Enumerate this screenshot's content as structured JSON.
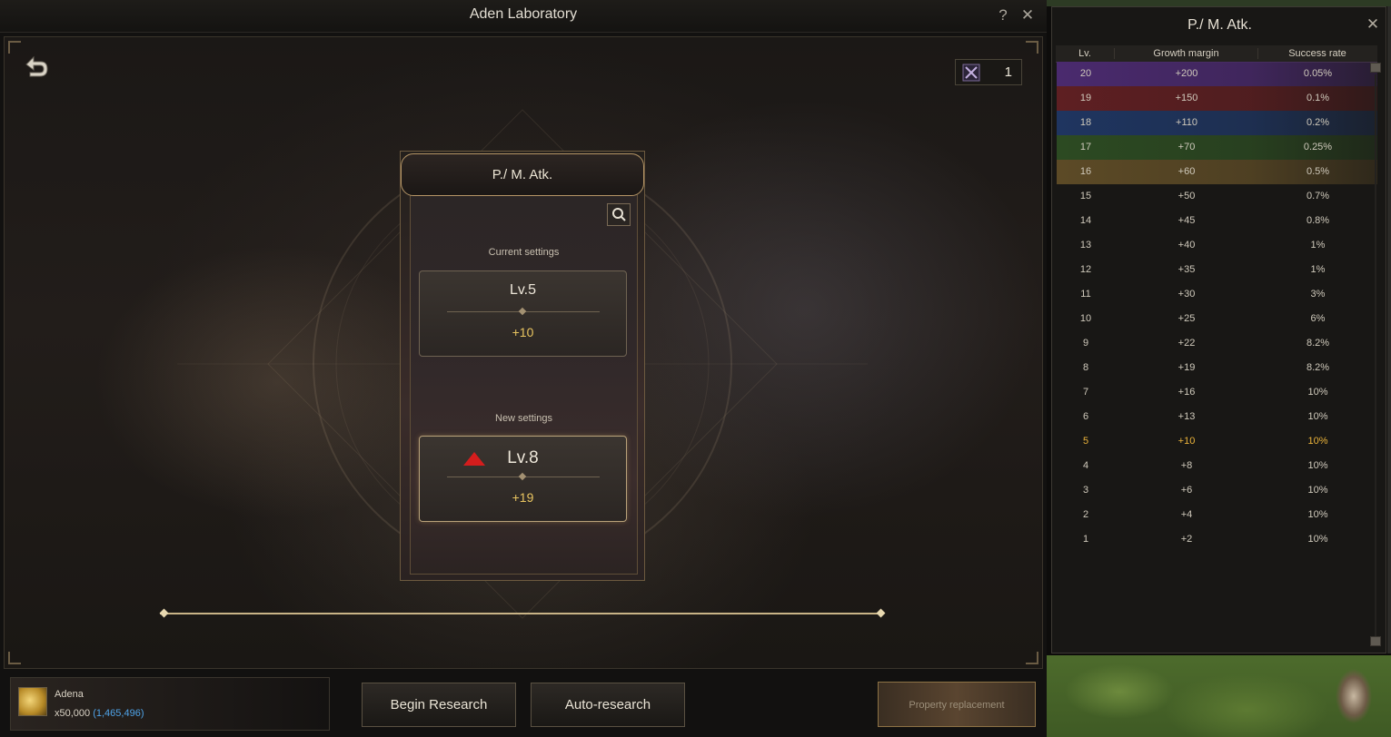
{
  "main_window": {
    "title": "Aden Laboratory",
    "help_glyph": "?",
    "close_glyph": "✕"
  },
  "ticket": {
    "icon": "crossed-swords-ticket-icon",
    "count": "1"
  },
  "card": {
    "stat_name": "P./ M. Atk.",
    "current_label": "Current settings",
    "current_level": "Lv.5",
    "current_value": "+10",
    "new_label": "New settings",
    "new_level": "Lv.8",
    "new_value": "+19",
    "new_indicator": "red-up-arrow-icon"
  },
  "adena": {
    "name": "Adena",
    "cost": "x50,000",
    "owned": "(1,465,496)"
  },
  "buttons": {
    "begin_research": "Begin Research",
    "auto_research": "Auto-research",
    "property_replacement": "Property replacement"
  },
  "side_panel": {
    "title": "P./ M. Atk.",
    "close_glyph": "✕",
    "columns": [
      "Lv.",
      "Growth margin",
      "Success rate"
    ],
    "rows": [
      {
        "lv": "20",
        "growth": "+200",
        "rate": "0.05%",
        "tier_color": "#4a2a6e"
      },
      {
        "lv": "19",
        "growth": "+150",
        "rate": "0.1%",
        "tier_color": "#5e1f22"
      },
      {
        "lv": "18",
        "growth": "+110",
        "rate": "0.2%",
        "tier_color": "#1f3560"
      },
      {
        "lv": "17",
        "growth": "+70",
        "rate": "0.25%",
        "tier_color": "#2c4a22"
      },
      {
        "lv": "16",
        "growth": "+60",
        "rate": "0.5%",
        "tier_color": "#5c4a26"
      },
      {
        "lv": "15",
        "growth": "+50",
        "rate": "0.7%",
        "tier_color": ""
      },
      {
        "lv": "14",
        "growth": "+45",
        "rate": "0.8%",
        "tier_color": ""
      },
      {
        "lv": "13",
        "growth": "+40",
        "rate": "1%",
        "tier_color": ""
      },
      {
        "lv": "12",
        "growth": "+35",
        "rate": "1%",
        "tier_color": ""
      },
      {
        "lv": "11",
        "growth": "+30",
        "rate": "3%",
        "tier_color": ""
      },
      {
        "lv": "10",
        "growth": "+25",
        "rate": "6%",
        "tier_color": ""
      },
      {
        "lv": "9",
        "growth": "+22",
        "rate": "8.2%",
        "tier_color": ""
      },
      {
        "lv": "8",
        "growth": "+19",
        "rate": "8.2%",
        "tier_color": ""
      },
      {
        "lv": "7",
        "growth": "+16",
        "rate": "10%",
        "tier_color": ""
      },
      {
        "lv": "6",
        "growth": "+13",
        "rate": "10%",
        "tier_color": ""
      },
      {
        "lv": "5",
        "growth": "+10",
        "rate": "10%",
        "tier_color": "",
        "current": true
      },
      {
        "lv": "4",
        "growth": "+8",
        "rate": "10%",
        "tier_color": ""
      },
      {
        "lv": "3",
        "growth": "+6",
        "rate": "10%",
        "tier_color": ""
      },
      {
        "lv": "2",
        "growth": "+4",
        "rate": "10%",
        "tier_color": ""
      },
      {
        "lv": "1",
        "growth": "+2",
        "rate": "10%",
        "tier_color": ""
      }
    ],
    "current_row_color": "#e9b23a"
  }
}
